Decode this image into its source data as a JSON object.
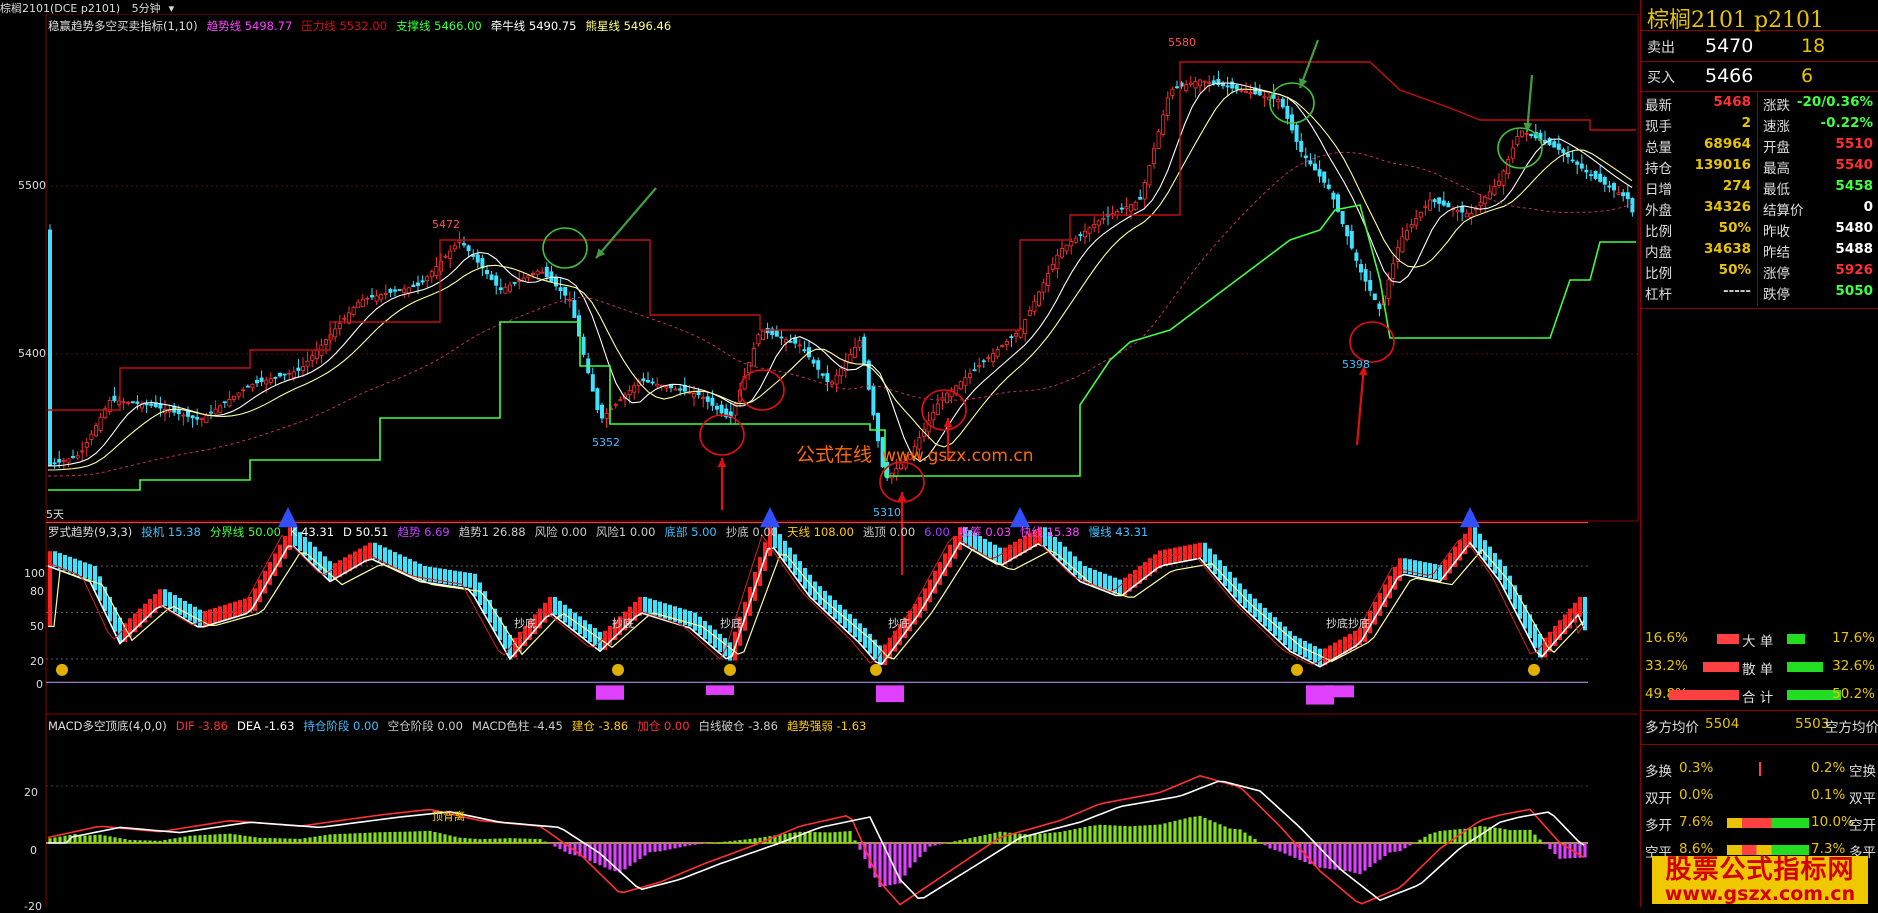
{
  "titlebar": {
    "symbol": "棕榈2101(DCE p2101)",
    "period": "5分钟"
  },
  "main_indicator": {
    "name": "稳赢趋势多空买卖指标(1,10)",
    "items": [
      {
        "label": "趋势线 5498.77",
        "color": "#ff40ff"
      },
      {
        "label": "压力线 5532.00",
        "color": "#d01010"
      },
      {
        "label": "支撑线 5466.00",
        "color": "#40ff40"
      },
      {
        "label": "牵牛线 5490.75",
        "color": "#ffffff"
      },
      {
        "label": "熊星线 5496.46",
        "color": "#ffff80"
      }
    ]
  },
  "main_axis": {
    "labels": [
      "5500",
      "5400"
    ]
  },
  "price_marks": [
    "5580",
    "5472",
    "5352",
    "5310",
    "5398"
  ],
  "watermark_center": {
    "cn": "公式在线",
    "url": "www.gszx.com.cn"
  },
  "period_label": "5天",
  "kd_indicator": {
    "name": "罗式趋势(9,3,3)",
    "items": [
      {
        "label": "投机 15.38",
        "color": "#40c0ff"
      },
      {
        "label": "分界线 50.00",
        "color": "#40ff40"
      },
      {
        "label": "K 43.31",
        "color": "#ffffff"
      },
      {
        "label": "D 50.51",
        "color": "#ffffff"
      },
      {
        "label": "趋势 6.69",
        "color": "#c040ff"
      },
      {
        "label": "趋势1 26.88",
        "color": "#cccccc"
      },
      {
        "label": "风险 0.00",
        "color": "#cccccc"
      },
      {
        "label": "风险1 0.00",
        "color": "#cccccc"
      },
      {
        "label": "底部 5.00",
        "color": "#40c0ff"
      },
      {
        "label": "抄底 0.00",
        "color": "#cccccc"
      },
      {
        "label": "天线 108.00",
        "color": "#ffcc00"
      },
      {
        "label": "逃顶 0.00",
        "color": "#cccccc"
      },
      {
        "label": "6.00",
        "color": "#a040ff"
      },
      {
        "label": "吸筹 0.03",
        "color": "#ff40ff"
      },
      {
        "label": "快线 15.38",
        "color": "#ff40ff"
      },
      {
        "label": "慢线 43.31",
        "color": "#40c0ff"
      }
    ],
    "axis": [
      "100",
      "80",
      "50",
      "20",
      "0"
    ],
    "marker_text": "抄底",
    "marker_text2": "抄底抄底"
  },
  "macd_indicator": {
    "name": "MACD多空顶底(4,0,0)",
    "items": [
      {
        "label": "DIF -3.86",
        "color": "#ff3030"
      },
      {
        "label": "DEA -1.63",
        "color": "#ffffff"
      },
      {
        "label": "持仓阶段 0.00",
        "color": "#40c0ff"
      },
      {
        "label": "空仓阶段 0.00",
        "color": "#cccccc"
      },
      {
        "label": "MACD色柱 -4.45",
        "color": "#cccccc"
      },
      {
        "label": "建仓 -3.86",
        "color": "#ffcc00"
      },
      {
        "label": "加仓 0.00",
        "color": "#ff3030"
      },
      {
        "label": "白线破仓 -3.86",
        "color": "#cccccc"
      },
      {
        "label": "趋势强弱 -1.63",
        "color": "#ffcc00"
      }
    ],
    "axis": [
      "20",
      "0",
      "-20"
    ],
    "marker_top": "顶背离"
  },
  "side": {
    "title": "棕榈2101  p2101",
    "sell": {
      "label": "卖出",
      "price": "5470",
      "vol": "18"
    },
    "buy": {
      "label": "买入",
      "price": "5466",
      "vol": "6"
    },
    "stats_left": [
      {
        "k": "最新",
        "v": "5468",
        "c": "#ff3030"
      },
      {
        "k": "现手",
        "v": "2",
        "c": "#e8c400"
      },
      {
        "k": "总量",
        "v": "68964",
        "c": "#e8c400"
      },
      {
        "k": "持仓",
        "v": "139016",
        "c": "#e8c400"
      },
      {
        "k": "日增",
        "v": "274",
        "c": "#e8c400"
      },
      {
        "k": "外盘",
        "v": "34326",
        "c": "#e8c400"
      },
      {
        "k": "比例",
        "v": "50%",
        "c": "#e8c400"
      },
      {
        "k": "内盘",
        "v": "34638",
        "c": "#e8c400"
      },
      {
        "k": "比例",
        "v": "50%",
        "c": "#e8c400"
      },
      {
        "k": "杠杆",
        "v": "-----",
        "c": "#ccc"
      }
    ],
    "stats_right": [
      {
        "k": "涨跌",
        "v": "-20/0.36%",
        "c": "#40ff40"
      },
      {
        "k": "速涨",
        "v": "-0.22%",
        "c": "#40ff40"
      },
      {
        "k": "开盘",
        "v": "5510",
        "c": "#ff3030"
      },
      {
        "k": "最高",
        "v": "5540",
        "c": "#ff3030"
      },
      {
        "k": "最低",
        "v": "5458",
        "c": "#40ff40"
      },
      {
        "k": "结算价",
        "v": "0",
        "c": "#fff"
      },
      {
        "k": "昨收",
        "v": "5480",
        "c": "#fff"
      },
      {
        "k": "昨结",
        "v": "5488",
        "c": "#fff"
      },
      {
        "k": "涨停",
        "v": "5926",
        "c": "#ff3030"
      },
      {
        "k": "跌停",
        "v": "5050",
        "c": "#40ff40"
      }
    ],
    "big": {
      "l": "16.6%",
      "k": "大 单",
      "r": "17.6%"
    },
    "retail": {
      "l": "33.2%",
      "k": "散 单",
      "r": "32.6%"
    },
    "total": {
      "l": "49.8%",
      "k": "合 计",
      "r": "50.2%"
    },
    "avg_left": "多方均价",
    "avg_left_val": "5504",
    "avg_right_val": "5503",
    "avg_right": "空方均价",
    "pos": [
      {
        "k": "多换",
        "l": "0.3%",
        "r": "0.2%",
        "k2": "空换"
      },
      {
        "k": "双开",
        "l": "0.0%",
        "r": "0.1%",
        "k2": "双平"
      },
      {
        "k": "多开",
        "l": "7.6%",
        "r": "10.0%",
        "k2": "空开"
      },
      {
        "k": "空平",
        "l": "8.6%",
        "r": "7.3%",
        "k2": "多平"
      }
    ]
  },
  "watermark": {
    "line1": "股票公式指标网",
    "line2": "www.gszx.com.cn"
  }
}
